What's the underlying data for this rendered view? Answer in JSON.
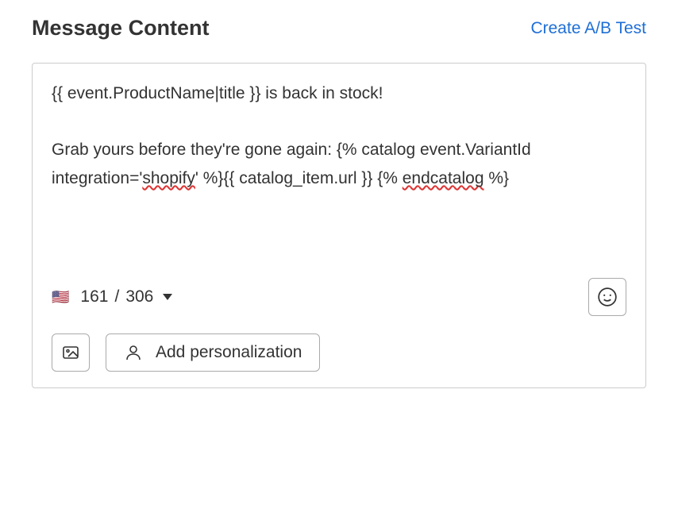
{
  "header": {
    "title": "Message Content",
    "create_ab_label": "Create A/B Test"
  },
  "message": {
    "line1_prefix": "{{ event.ProductName|title }} is back in stock!",
    "line2_prefix": "Grab yours before they're gone again: {% catalog event.VariantId integration='",
    "spell_shopify": "shopify",
    "line2_suffix": "' %}{{ catalog_item.url }} {% ",
    "spell_endcatalog": "endcatalog",
    "line2_end": " %}"
  },
  "counter": {
    "flag_icon_name": "us-flag",
    "current": "161",
    "separator": "/",
    "max": "306"
  },
  "buttons": {
    "add_personalization": "Add personalization"
  }
}
